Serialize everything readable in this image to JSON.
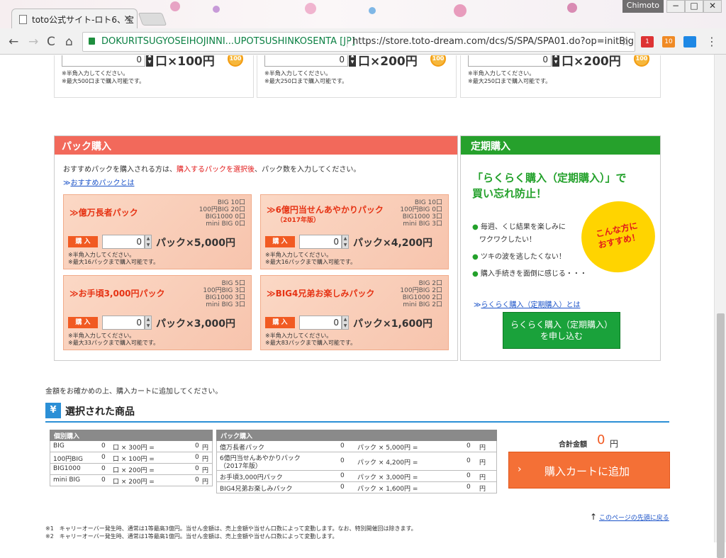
{
  "browser": {
    "tab_title": "toto公式サイト-ロト6、宝",
    "tab_close": "×",
    "profile_name": "Chimoto",
    "win_min": "−",
    "win_max": "□",
    "win_close": "✕",
    "back": "←",
    "forward": "→",
    "reload": "C",
    "home": "⌂",
    "secure_label": "DOKURITSUGYOSEIHOJINNI...UPOTSUSHINKOSENTA [JP]",
    "url": "https://store.toto-dream.com/dcs/S/SPA/SPA01.do?op=initBig",
    "star": "☆",
    "ext_gmail_count": "1",
    "ext_rss_count": "10",
    "menu": "⋮"
  },
  "individual": {
    "columns": [
      {
        "value": "0",
        "unit": "口×100円",
        "coin": "100",
        "note1": "※半角入力してください。",
        "note2": "※最大500口まで購入可能です。"
      },
      {
        "value": "0",
        "unit": "口×200円",
        "coin": "100",
        "note1": "※半角入力してください。",
        "note2": "※最大250口まで購入可能です。"
      },
      {
        "value": "0",
        "unit": "口×200円",
        "coin": "100",
        "note1": "※半角入力してください。",
        "note2": "※最大250口まで購入可能です。"
      }
    ]
  },
  "pack": {
    "header": "パック購入",
    "desc_a": "おすすめパックを購入される方は、",
    "desc_red": "購入するパックを選択後",
    "desc_b": "、パック数を入力してください。",
    "link": "おすすめパックとは",
    "buy_label": "購 入",
    "cards": [
      {
        "title": "≫億万長者パック",
        "sub": "",
        "breakdown": [
          "BIG 10口",
          "100円BIG 20口",
          "BIG1000 0口",
          "mini BIG 0口"
        ],
        "value": "0",
        "price": "パック×5,000円",
        "note1": "※半角入力してください。",
        "note2": "※最大16パックまで購入可能です。"
      },
      {
        "title": "≫6億円当せんあやかりパック",
        "sub": "（2017年版）",
        "breakdown": [
          "BIG 10口",
          "100円BIG 0口",
          "BIG1000 3口",
          "mini BIG 3口"
        ],
        "value": "0",
        "price": "パック×4,200円",
        "note1": "※半角入力してください。",
        "note2": "※最大16パックまで購入可能です。"
      },
      {
        "title": "≫お手頃3,000円パック",
        "sub": "",
        "breakdown": [
          "BIG 5口",
          "100円BIG 3口",
          "BIG1000 3口",
          "mini BIG 3口"
        ],
        "value": "0",
        "price": "パック×3,000円",
        "note1": "※半角入力してください。",
        "note2": "※最大33パックまで購入可能です。"
      },
      {
        "title": "≫BIG4兄弟お楽しみパック",
        "sub": "",
        "breakdown": [
          "BIG 2口",
          "100円BIG 2口",
          "BIG1000 2口",
          "mini BIG 2口"
        ],
        "value": "0",
        "price": "パック×1,600円",
        "note1": "※半角入力してください。",
        "note2": "※最大83パックまで購入可能です。"
      }
    ]
  },
  "periodic": {
    "header": "定期購入",
    "title1": "「らくらく購入（定期購入）」で",
    "title2": "買い忘れ防止！",
    "badge1": "こんな方に",
    "badge2": "おすすめ！",
    "bullets": [
      "毎週、くじ結果を楽しみに",
      "ワクワクしたい！",
      "ツキの波を逃したくない！",
      "購入手続きを面倒に感じる・・・"
    ],
    "link": "らくらく購入（定期購入）とは",
    "button1": "らくらく購入（定期購入）",
    "button2": "を申し込む"
  },
  "confirm_text": "金額をお確かめの上、購入カートに追加してください。",
  "selected": {
    "icon": "¥",
    "title": "選択された商品",
    "individual_header": "個別購入",
    "individual_rows": [
      {
        "name": "BIG",
        "qty": "0",
        "calc": "口 × 300円 =",
        "amount": "0",
        "yen": "円"
      },
      {
        "name": "100円BIG",
        "qty": "0",
        "calc": "口 × 100円 =",
        "amount": "0",
        "yen": "円"
      },
      {
        "name": "BIG1000",
        "qty": "0",
        "calc": "口 × 200円 =",
        "amount": "0",
        "yen": "円"
      },
      {
        "name": "mini BIG",
        "qty": "0",
        "calc": "口 × 200円 =",
        "amount": "0",
        "yen": "円"
      }
    ],
    "pack_header": "パック購入",
    "pack_rows": [
      {
        "name": "億万長者パック",
        "name2": "",
        "qty": "0",
        "calc": "パック × 5,000円 =",
        "amount": "0",
        "yen": "円"
      },
      {
        "name": "6億円当せんあやかりパック",
        "name2": "（2017年版）",
        "qty": "0",
        "calc": "パック × 4,200円 =",
        "amount": "0",
        "yen": "円"
      },
      {
        "name": "お手頃3,000円パック",
        "name2": "",
        "qty": "0",
        "calc": "パック × 3,000円 =",
        "amount": "0",
        "yen": "円"
      },
      {
        "name": "BIG4兄弟お楽しみパック",
        "name2": "",
        "qty": "0",
        "calc": "パック × 1,600円 =",
        "amount": "0",
        "yen": "円"
      }
    ],
    "total_label": "合計金額",
    "total_value": "0",
    "total_unit": "円",
    "cart_button": "購入カートに追加",
    "cart_arrow": "›"
  },
  "to_top": "このページの先頭に戻る",
  "footnotes": [
    "※1　キャリーオーバー発生時、通常は1等最高3億円。当せん金額は、売上金額や当せん口数によって変動します。なお、特別開催回は除きます。",
    "※2　キャリーオーバー発生時、通常は1等最高1億円。当せん金額は、売上金額や当せん口数によって変動します。"
  ],
  "colors": {
    "pack_header": "#f2695b",
    "period_header": "#26a12c",
    "cart_button": "#f47036",
    "accent_blue": "#2b8fd6"
  }
}
